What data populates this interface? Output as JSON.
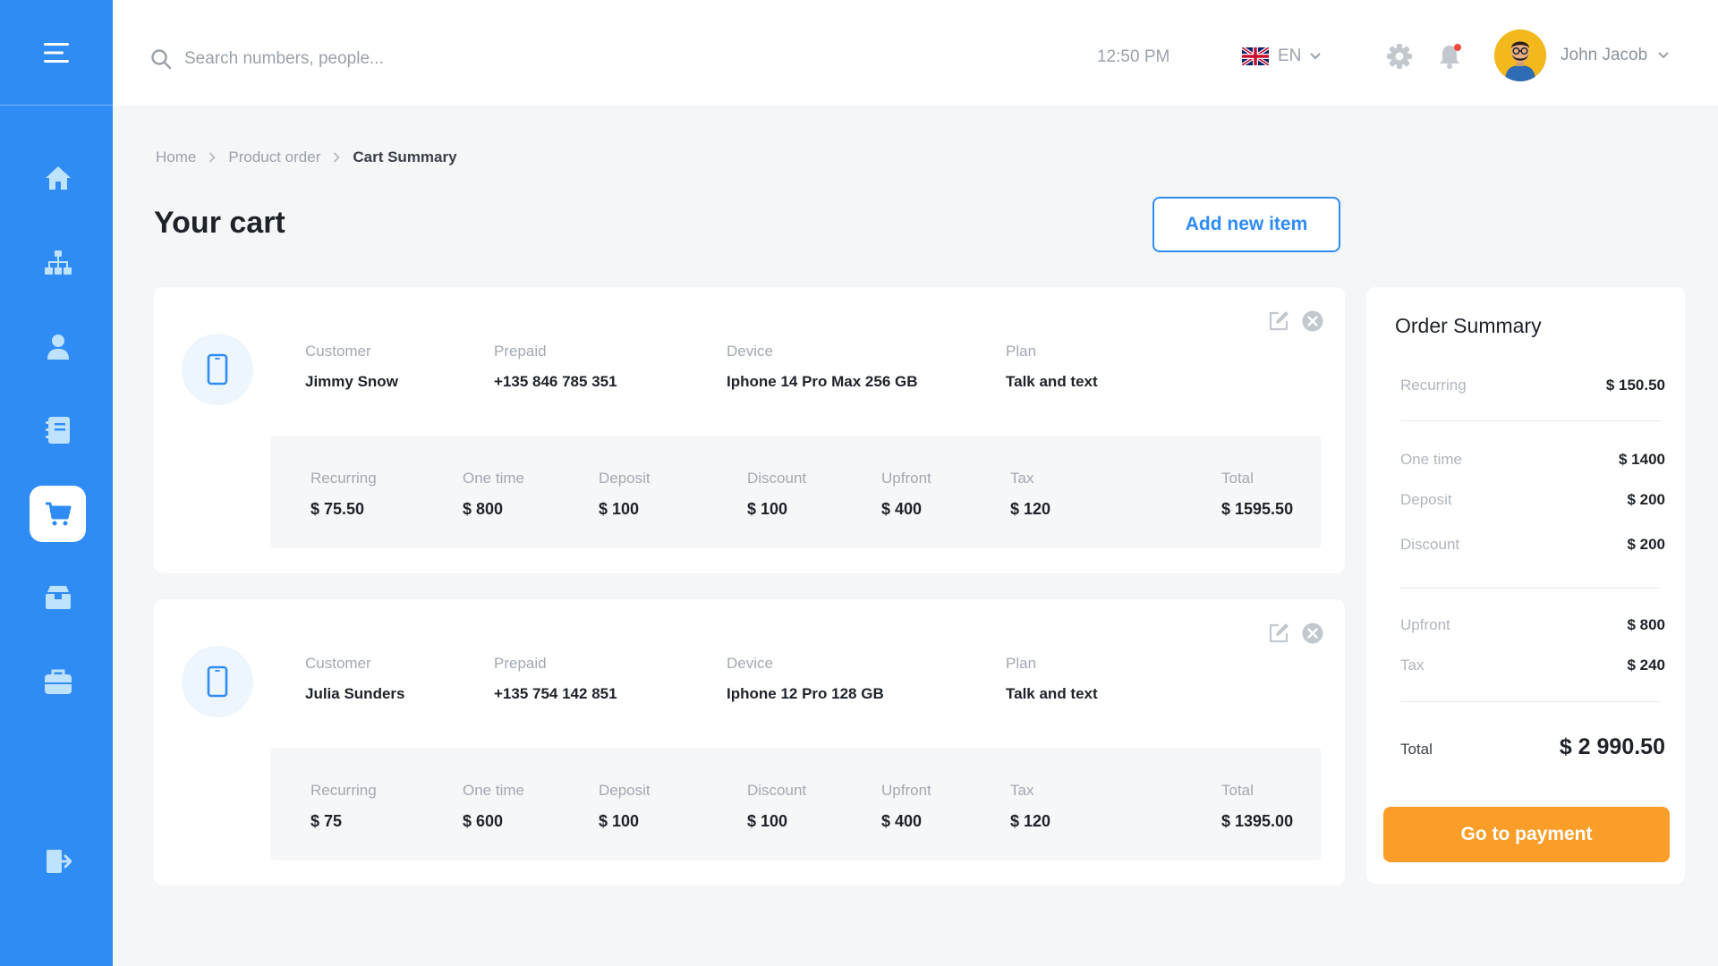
{
  "search": {
    "placeholder": "Search numbers, people..."
  },
  "header": {
    "time": "12:50 PM",
    "language": "EN",
    "user_name": "John Jacob"
  },
  "breadcrumb": [
    "Home",
    "Product order",
    "Cart Summary"
  ],
  "page": {
    "title": "Your cart",
    "add_button": "Add new item"
  },
  "cart_items": [
    {
      "customer_label": "Customer",
      "customer": "Jimmy Snow",
      "prepaid_label": "Prepaid",
      "prepaid": "+135 846 785 351",
      "device_label": "Device",
      "device": "Iphone 14 Pro Max 256 GB",
      "plan_label": "Plan",
      "plan": "Talk and text",
      "prices": [
        {
          "label": "Recurring",
          "value": "$ 75.50"
        },
        {
          "label": "One time",
          "value": "$ 800"
        },
        {
          "label": "Deposit",
          "value": "$ 100"
        },
        {
          "label": "Discount",
          "value": "$ 100"
        },
        {
          "label": "Upfront",
          "value": "$ 400"
        },
        {
          "label": "Tax",
          "value": "$ 120"
        },
        {
          "label": "Total",
          "value": "$ 1595.50"
        }
      ]
    },
    {
      "customer_label": "Customer",
      "customer": "Julia Sunders",
      "prepaid_label": "Prepaid",
      "prepaid": "+135 754 142 851",
      "device_label": "Device",
      "device": "Iphone 12 Pro 128 GB",
      "plan_label": "Plan",
      "plan": "Talk and text",
      "prices": [
        {
          "label": "Recurring",
          "value": "$ 75"
        },
        {
          "label": "One time",
          "value": "$ 600"
        },
        {
          "label": "Deposit",
          "value": "$ 100"
        },
        {
          "label": "Discount",
          "value": "$ 100"
        },
        {
          "label": "Upfront",
          "value": "$ 400"
        },
        {
          "label": "Tax",
          "value": "$ 120"
        },
        {
          "label": "Total",
          "value": "$ 1395.00"
        }
      ]
    }
  ],
  "summary": {
    "title": "Order Summary",
    "rows": [
      {
        "label": "Recurring",
        "value": "$ 150.50"
      },
      {
        "label": "One time",
        "value": "$ 1400"
      },
      {
        "label": "Deposit",
        "value": "$ 200"
      },
      {
        "label": "Discount",
        "value": "$ 200"
      },
      {
        "label": "Upfront",
        "value": "$ 800"
      },
      {
        "label": "Tax",
        "value": "$ 240"
      }
    ],
    "total_label": "Total",
    "total_value": "$ 2 990.50",
    "pay_button": "Go to payment"
  },
  "colors": {
    "accent": "#2f8cf5",
    "pay": "#fb9e29",
    "notification": "#f0493e"
  },
  "icons": {
    "sidebar": [
      "menu-icon",
      "home-icon",
      "hierarchy-icon",
      "user-icon",
      "book-icon",
      "cart-icon",
      "box-icon",
      "briefcase-icon",
      "logout-icon"
    ],
    "header": [
      "search-icon",
      "uk-flag-icon",
      "chevron-down-icon",
      "gear-icon",
      "bell-icon"
    ],
    "card": [
      "phone-icon",
      "edit-icon",
      "close-icon"
    ]
  }
}
